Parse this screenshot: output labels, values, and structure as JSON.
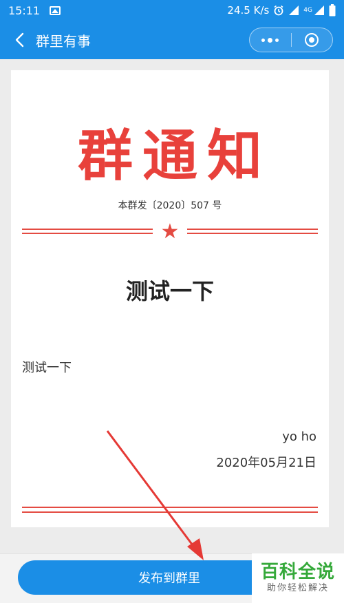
{
  "status_bar": {
    "time": "15:11",
    "net_speed": "24.5 K/s",
    "net_label": "4G",
    "icons": [
      "image-icon",
      "alarm-icon",
      "signal-icon",
      "battery-icon"
    ]
  },
  "nav": {
    "title": "群里有事",
    "icons": [
      "back-icon",
      "more-dots-icon",
      "target-icon"
    ]
  },
  "document": {
    "headline": "群通知",
    "number": "本群发〔2020〕507 号",
    "title": "测试一下",
    "body": "测试一下",
    "signature": "yo ho",
    "date": "2020年05月21日",
    "accent_color": "#e8413b"
  },
  "actions": {
    "publish_label": "发布到群里"
  },
  "watermark": {
    "main": "百科全说",
    "sub": "助你轻松解决"
  },
  "colors": {
    "primary": "#1b8ee6",
    "accent": "#e8413b"
  }
}
